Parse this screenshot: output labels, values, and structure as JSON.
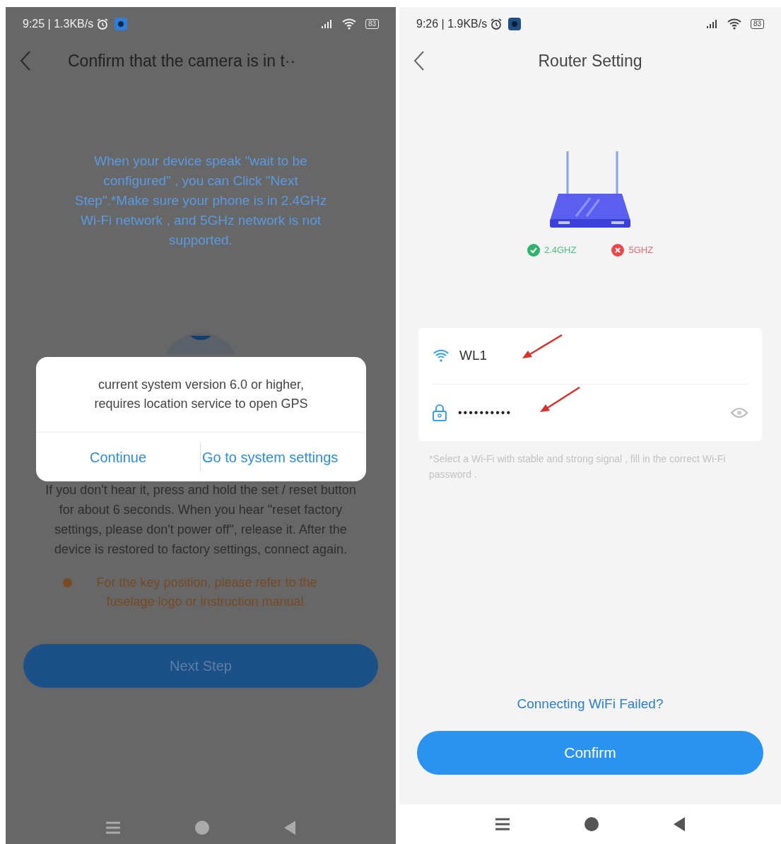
{
  "left_screen": {
    "status_bar": {
      "time_speed": "9:25 | 1.3KB/s",
      "battery": "83"
    },
    "title": "Confirm that the camera is in t··",
    "instruction": "When your device speak \"wait to be configured\" , you can Click \"Next Step\".*Make sure your phone is in 2.4GHz Wi-Fi network , and 5GHz network is not supported.",
    "reset_text": "If you don't hear it, press and hold the set / reset button for about 6 seconds. When you hear \"reset factory settings, please don't power off\", release it. After the device is restored to factory settings, connect again.",
    "note": "For the key position, please refer to the fuselage logo or instruction manual.",
    "next_button": "Next Step",
    "dialog": {
      "message": "current system version 6.0 or higher, requires location service to open GPS",
      "buttons": [
        "Continue",
        "Go to system settings"
      ]
    }
  },
  "right_screen": {
    "status_bar": {
      "time_speed": "9:26 | 1.9KB/s",
      "battery": "83"
    },
    "title": "Router Setting",
    "bands": [
      {
        "label": "2.4GHZ",
        "supported": true
      },
      {
        "label": "5GHZ",
        "supported": false
      }
    ],
    "wifi_name": "WL1",
    "password": "••••••••••",
    "hint": "*Select a Wi-Fi with stable and strong signal , fill in the correct Wi-Fi password .",
    "help_link": "Connecting WiFi Failed?",
    "confirm_button": "Confirm"
  }
}
